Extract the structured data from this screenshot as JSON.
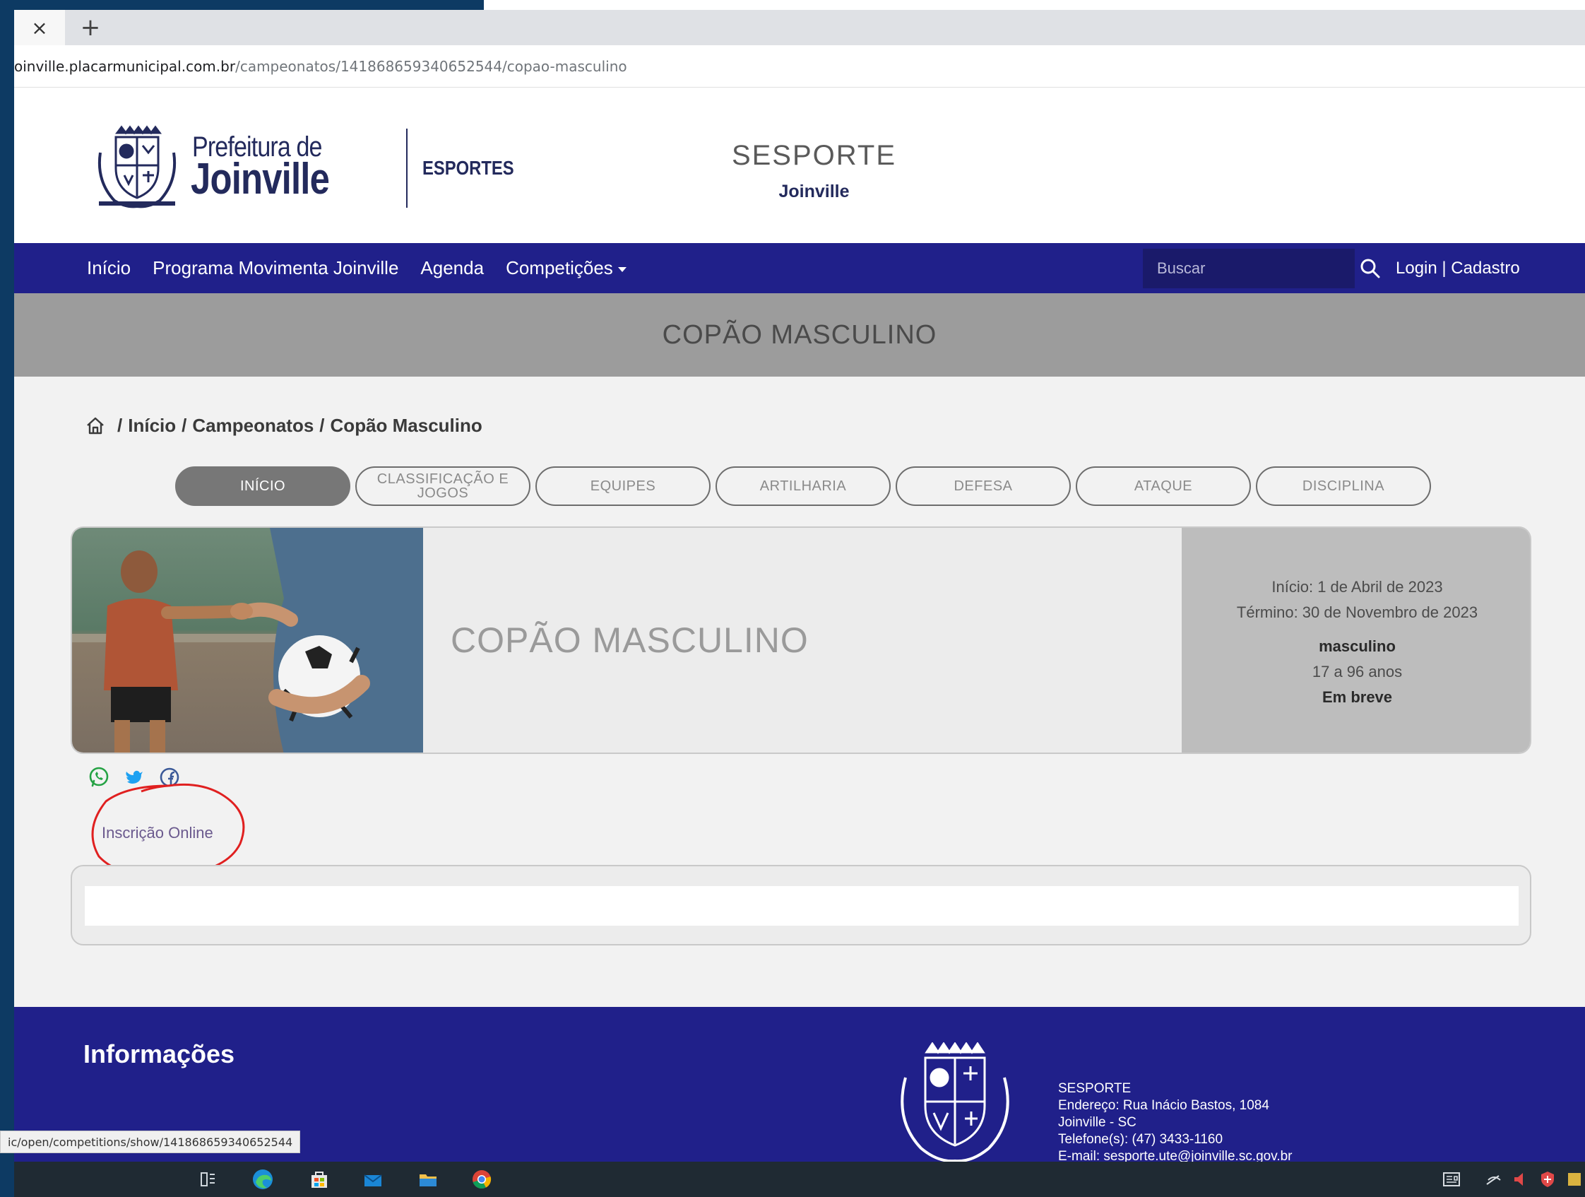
{
  "browser": {
    "tab_close": "×",
    "new_tab": "+",
    "url_host": "oinville.placarmunicipal.com.br",
    "url_path": "/campeonatos/141868659340652544/copao-masculino",
    "status_url": "ic/open/competitions/show/141868659340652544"
  },
  "header": {
    "logo_line1": "Prefeitura de",
    "logo_line2": "Joinville",
    "logo_sub": "ESPORTES",
    "brand_title": "SESPORTE",
    "brand_subtitle": "Joinville"
  },
  "nav": {
    "items": [
      "Início",
      "Programa Movimenta Joinville",
      "Agenda",
      "Competições"
    ],
    "search_placeholder": "Buscar",
    "login": "Login | Cadastro"
  },
  "page_title": "COPÃO MASCULINO",
  "breadcrumb": {
    "items": [
      "Início",
      "Campeonatos",
      "Copão Masculino"
    ],
    "separator": "/"
  },
  "tabs": [
    {
      "label": "INÍCIO",
      "active": true
    },
    {
      "label": "CLASSIFICAÇÃO E JOGOS",
      "active": false
    },
    {
      "label": "EQUIPES",
      "active": false
    },
    {
      "label": "ARTILHARIA",
      "active": false
    },
    {
      "label": "DEFESA",
      "active": false
    },
    {
      "label": "ATAQUE",
      "active": false
    },
    {
      "label": "DISCIPLINA",
      "active": false
    }
  ],
  "event": {
    "name": "COPÃO MASCULINO",
    "start": "Início: 1 de Abril de 2023",
    "end": "Término: 30 de Novembro de 2023",
    "gender": "masculino",
    "age": "17 a 96 anos",
    "status": "Em breve"
  },
  "share": {
    "icons": [
      "whatsapp-icon",
      "twitter-icon",
      "facebook-icon"
    ],
    "colors": {
      "whatsapp": "#25a244",
      "twitter": "#1da1f2",
      "facebook": "#3b5998"
    }
  },
  "inscricao_label": "Inscrição Online",
  "annotation_color": "#e02020",
  "footer": {
    "heading": "Informações",
    "org": "SESPORTE",
    "address": "Endereço: Rua Inácio Bastos, 1084",
    "city": "Joinville - SC",
    "phone": "Telefone(s): (47) 3433-1160",
    "email": "E-mail: sesporte.ute@joinville.sc.gov.br"
  },
  "colors": {
    "nav_bg": "#20208a",
    "title_band": "#9c9c9c",
    "outer_bg": "#0d3a63"
  }
}
